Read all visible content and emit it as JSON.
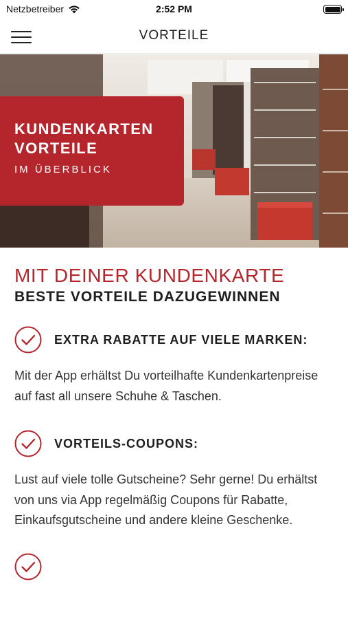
{
  "status_bar": {
    "carrier": "Netzbetreiber",
    "time": "2:52 PM",
    "battery_level": 1.0
  },
  "nav": {
    "title": "VORTEILE",
    "menu_icon": "hamburger-menu-icon"
  },
  "hero": {
    "line1": "KUNDENKARTEN",
    "line2": "VORTEILE",
    "subtitle": "IM ÜBERBLICK"
  },
  "intro": {
    "heading_red": "MIT DEINER KUNDENKARTE",
    "heading_dark": "BESTE VORTEILE DAZUGEWINNEN"
  },
  "benefits": [
    {
      "icon": "check-circle-icon",
      "title": "EXTRA RABATTE AUF VIELE MARKEN:",
      "text": "Mit der App erhältst Du vorteilhafte Kundenkartenpreise auf fast all unsere Schuhe & Taschen."
    },
    {
      "icon": "check-circle-icon",
      "title": "VORTEILS-COUPONS:",
      "text": "Lust auf viele tolle Gutscheine? Sehr gerne! Du erhältst von uns via App regelmäßig Coupons für Rabatte, Einkaufsgutscheine und andere kleine Geschenke."
    },
    {
      "icon": "check-circle-icon"
    }
  ],
  "colors": {
    "brand_red": "#b5262c",
    "text_dark": "#1e1e1e"
  }
}
